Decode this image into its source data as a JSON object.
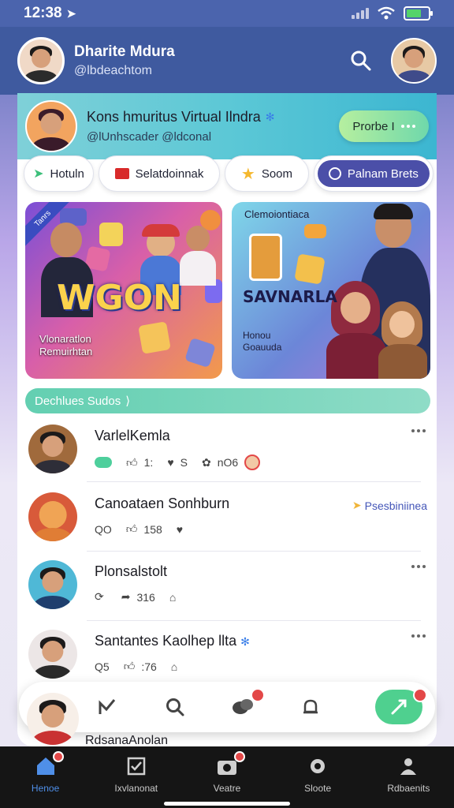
{
  "status_bar": {
    "time": "12:38"
  },
  "header": {
    "name": "Dharite Mdura",
    "handle": "@lbdeachtom"
  },
  "profile_banner": {
    "title": "Kons hmuritus Virtual Ilndra",
    "subtitle": "@lUnhscader @ldconal",
    "button_label": "Prorbe I"
  },
  "chips": [
    {
      "label": "Hotuln"
    },
    {
      "label": "Selatdoinnak"
    },
    {
      "label": "Soom"
    },
    {
      "label": "Palnam Brets"
    }
  ],
  "promos": {
    "left": {
      "ribbon": "Tanrs",
      "title": "WGON",
      "caption_line1": "Vlonaratlon",
      "caption_line2": "Remuirhtan"
    },
    "right": {
      "top_label": "Clemoiontiaca",
      "title": "SAVNARLA",
      "caption_line1": "Honou",
      "caption_line2": "Goauuda"
    }
  },
  "section_pill": {
    "label": "Dechlues Sudos"
  },
  "feed": [
    {
      "title": "VarlelKemla",
      "meta": [
        "1:",
        "S",
        "nO6"
      ],
      "tag": ""
    },
    {
      "title": "Canoataen Sonhburn",
      "meta": [
        "QO",
        "158"
      ],
      "tag": "Psesbiniinea"
    },
    {
      "title": "Plonsalstolt",
      "meta": [
        "316"
      ],
      "tag": ""
    },
    {
      "title": "Santantes Kaolhep llta",
      "meta": [
        "Q5",
        ":76"
      ],
      "tag": ""
    }
  ],
  "peek_text": "RdsanaAnolan",
  "tab_bar": [
    {
      "label": "Henoe",
      "active": true
    },
    {
      "label": "Ixvlanonat",
      "active": false
    },
    {
      "label": "Veatre",
      "active": false
    },
    {
      "label": "Sloote",
      "active": false
    },
    {
      "label": "Rdbaenits",
      "active": false
    }
  ],
  "colors": {
    "header": "#3f5a9f",
    "accent": "#4fd08f",
    "tab_active": "#4f8fe8",
    "badge": "#e34848"
  }
}
